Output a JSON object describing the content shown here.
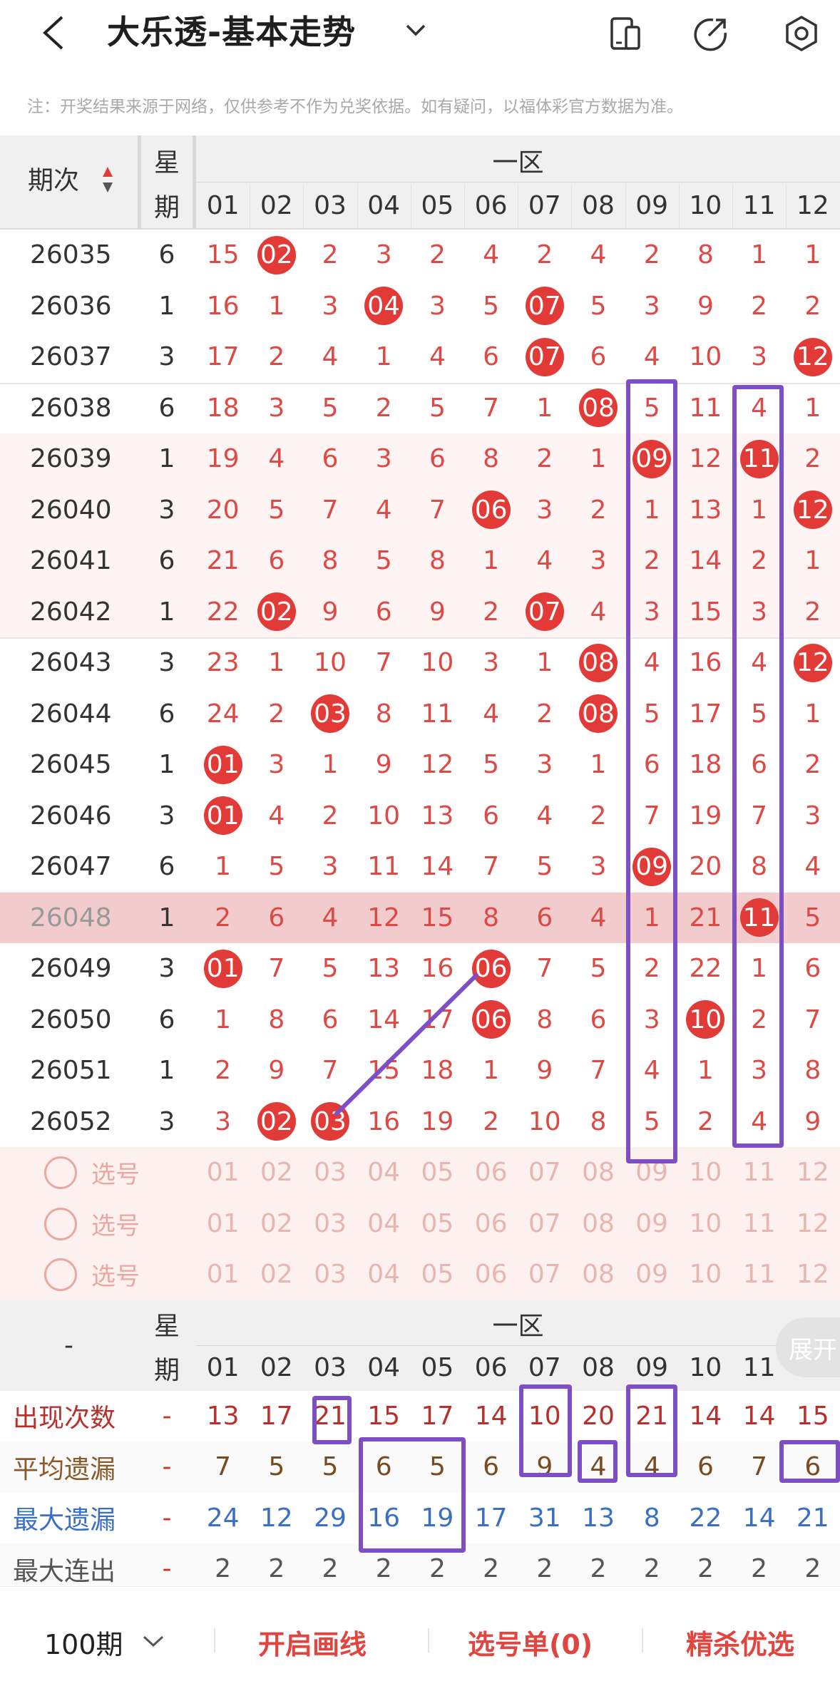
{
  "header": {
    "title": "大乐透-基本走势",
    "icons": [
      "back-icon",
      "chevron-down-icon",
      "phone-icon",
      "share-icon",
      "settings-icon"
    ]
  },
  "notice": "注：开奖结果来源于网络，仅供参考不作为兑奖依据。如有疑问，以福体彩官方数据为准。",
  "table": {
    "col_period": "期次",
    "col_week": [
      "星",
      "期"
    ],
    "zone": "一区",
    "numbers": [
      "01",
      "02",
      "03",
      "04",
      "05",
      "06",
      "07",
      "08",
      "09",
      "10",
      "11",
      "12"
    ],
    "rows": [
      {
        "period": "26035",
        "week": "6",
        "cells": [
          "15",
          "02",
          "2",
          "3",
          "2",
          "4",
          "2",
          "4",
          "2",
          "8",
          "1",
          "1"
        ],
        "hits": [
          1
        ]
      },
      {
        "period": "26036",
        "week": "1",
        "cells": [
          "16",
          "1",
          "3",
          "04",
          "3",
          "5",
          "07",
          "5",
          "3",
          "9",
          "2",
          "2"
        ],
        "hits": [
          3,
          6
        ]
      },
      {
        "period": "26037",
        "week": "3",
        "cells": [
          "17",
          "2",
          "4",
          "1",
          "4",
          "6",
          "07",
          "6",
          "4",
          "10",
          "3",
          "12"
        ],
        "hits": [
          6,
          11
        ]
      },
      {
        "period": "26038",
        "week": "6",
        "cells": [
          "18",
          "3",
          "5",
          "2",
          "5",
          "7",
          "1",
          "08",
          "5",
          "11",
          "4",
          "1"
        ],
        "hits": [
          7
        ]
      },
      {
        "period": "26039",
        "week": "1",
        "cells": [
          "19",
          "4",
          "6",
          "3",
          "6",
          "8",
          "2",
          "1",
          "09",
          "12",
          "11",
          "2"
        ],
        "hits": [
          8,
          10
        ]
      },
      {
        "period": "26040",
        "week": "3",
        "cells": [
          "20",
          "5",
          "7",
          "4",
          "7",
          "06",
          "3",
          "2",
          "1",
          "13",
          "1",
          "12"
        ],
        "hits": [
          5,
          11
        ]
      },
      {
        "period": "26041",
        "week": "6",
        "cells": [
          "21",
          "6",
          "8",
          "5",
          "8",
          "1",
          "4",
          "3",
          "2",
          "14",
          "2",
          "1"
        ],
        "hits": []
      },
      {
        "period": "26042",
        "week": "1",
        "cells": [
          "22",
          "02",
          "9",
          "6",
          "9",
          "2",
          "07",
          "4",
          "3",
          "15",
          "3",
          "2"
        ],
        "hits": [
          1,
          6
        ]
      },
      {
        "period": "26043",
        "week": "3",
        "cells": [
          "23",
          "1",
          "10",
          "7",
          "10",
          "3",
          "1",
          "08",
          "4",
          "16",
          "4",
          "12"
        ],
        "hits": [
          7,
          11
        ]
      },
      {
        "period": "26044",
        "week": "6",
        "cells": [
          "24",
          "2",
          "03",
          "8",
          "11",
          "4",
          "2",
          "08",
          "5",
          "17",
          "5",
          "1"
        ],
        "hits": [
          2,
          7
        ]
      },
      {
        "period": "26045",
        "week": "1",
        "cells": [
          "01",
          "3",
          "1",
          "9",
          "12",
          "5",
          "3",
          "1",
          "6",
          "18",
          "6",
          "2"
        ],
        "hits": [
          0
        ]
      },
      {
        "period": "26046",
        "week": "3",
        "cells": [
          "01",
          "4",
          "2",
          "10",
          "13",
          "6",
          "4",
          "2",
          "7",
          "19",
          "7",
          "3"
        ],
        "hits": [
          0
        ]
      },
      {
        "period": "26047",
        "week": "6",
        "cells": [
          "1",
          "5",
          "3",
          "11",
          "14",
          "7",
          "5",
          "3",
          "09",
          "20",
          "8",
          "4"
        ],
        "hits": [
          8
        ]
      },
      {
        "period": "26048",
        "week": "1",
        "cells": [
          "2",
          "6",
          "4",
          "12",
          "15",
          "8",
          "6",
          "4",
          "1",
          "21",
          "11",
          "5"
        ],
        "hits": [
          10
        ]
      },
      {
        "period": "26049",
        "week": "3",
        "cells": [
          "01",
          "7",
          "5",
          "13",
          "16",
          "06",
          "7",
          "5",
          "2",
          "22",
          "1",
          "6"
        ],
        "hits": [
          0,
          5
        ]
      },
      {
        "period": "26050",
        "week": "6",
        "cells": [
          "1",
          "8",
          "6",
          "14",
          "17",
          "06",
          "8",
          "6",
          "3",
          "10",
          "2",
          "7"
        ],
        "hits": [
          5,
          9
        ]
      },
      {
        "period": "26051",
        "week": "1",
        "cells": [
          "2",
          "9",
          "7",
          "15",
          "18",
          "1",
          "9",
          "7",
          "4",
          "1",
          "3",
          "8"
        ],
        "hits": []
      },
      {
        "period": "26052",
        "week": "3",
        "cells": [
          "3",
          "02",
          "03",
          "16",
          "19",
          "2",
          "10",
          "8",
          "5",
          "2",
          "4",
          "9"
        ],
        "hits": [
          1,
          2
        ]
      }
    ],
    "select_label": "选号",
    "select_rows": 3
  },
  "stats": {
    "dash": "-",
    "col_week": [
      "星",
      "期"
    ],
    "zone": "一区",
    "expand": "展开",
    "rows": [
      {
        "label": "出现次数",
        "color": "#b8302c",
        "week": "-",
        "values": [
          "13",
          "17",
          "21",
          "15",
          "17",
          "14",
          "10",
          "20",
          "21",
          "14",
          "14",
          "15"
        ],
        "value_color": "#b8302c"
      },
      {
        "label": "平均遗漏",
        "color": "#8a5a2a",
        "week": "-",
        "values": [
          "7",
          "5",
          "5",
          "6",
          "5",
          "6",
          "9",
          "4",
          "4",
          "6",
          "7",
          "6"
        ],
        "value_color": "#7a4a20"
      },
      {
        "label": "最大遗漏",
        "color": "#3a6fc4",
        "week": "-",
        "values": [
          "24",
          "12",
          "29",
          "16",
          "19",
          "17",
          "31",
          "13",
          "8",
          "22",
          "14",
          "21"
        ],
        "value_color": "#3a6fc4"
      },
      {
        "label": "最大连出",
        "color": "#555555",
        "week": "-",
        "values": [
          "2",
          "2",
          "2",
          "2",
          "2",
          "2",
          "2",
          "2",
          "2",
          "2",
          "2",
          "2"
        ],
        "value_color": "#555555"
      }
    ]
  },
  "bottom_bar": {
    "period_select": "100期",
    "draw_lines": "开启画线",
    "selection_list": "选号单(0)",
    "featured": "精杀优选"
  },
  "colors": {
    "accent": "#e23a36",
    "annotation": "#7d4fc2",
    "row_highlight": "#f2cccc"
  }
}
